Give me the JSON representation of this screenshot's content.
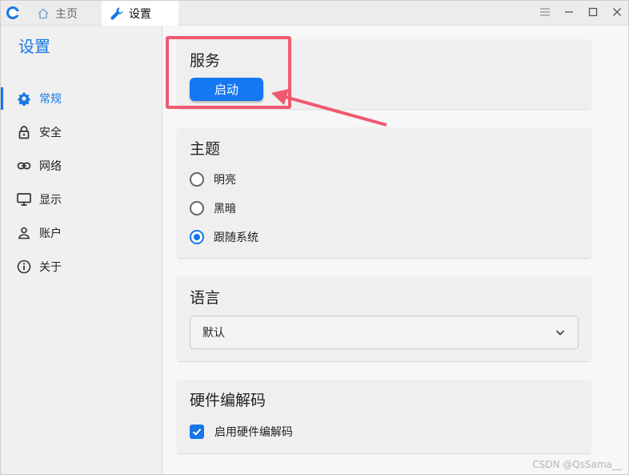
{
  "titlebar": {
    "tabs": [
      {
        "label": "主页",
        "icon": "home-icon"
      },
      {
        "label": "设置",
        "icon": "wrench-icon"
      }
    ],
    "controls": [
      "menu-icon",
      "minimize-icon",
      "maximize-icon",
      "close-icon"
    ]
  },
  "sidebar": {
    "title": "设置",
    "items": [
      {
        "label": "常规",
        "icon": "gear-icon",
        "active": true
      },
      {
        "label": "安全",
        "icon": "lock-icon"
      },
      {
        "label": "网络",
        "icon": "link-icon"
      },
      {
        "label": "显示",
        "icon": "monitor-icon"
      },
      {
        "label": "账户",
        "icon": "user-icon"
      },
      {
        "label": "关于",
        "icon": "info-icon"
      }
    ]
  },
  "service": {
    "title": "服务",
    "start_label": "启动"
  },
  "theme": {
    "title": "主题",
    "options": [
      {
        "label": "明亮",
        "checked": false
      },
      {
        "label": "黑暗",
        "checked": false
      },
      {
        "label": "跟随系统",
        "checked": true
      }
    ]
  },
  "language": {
    "title": "语言",
    "selected": "默认"
  },
  "hwcodec": {
    "title": "硬件编解码",
    "checkbox_label": "启用硬件编解码",
    "checked": true
  },
  "colors": {
    "accent": "#1677e6",
    "annotation": "#ee5a70"
  },
  "watermark": "CSDN @QsSama__"
}
